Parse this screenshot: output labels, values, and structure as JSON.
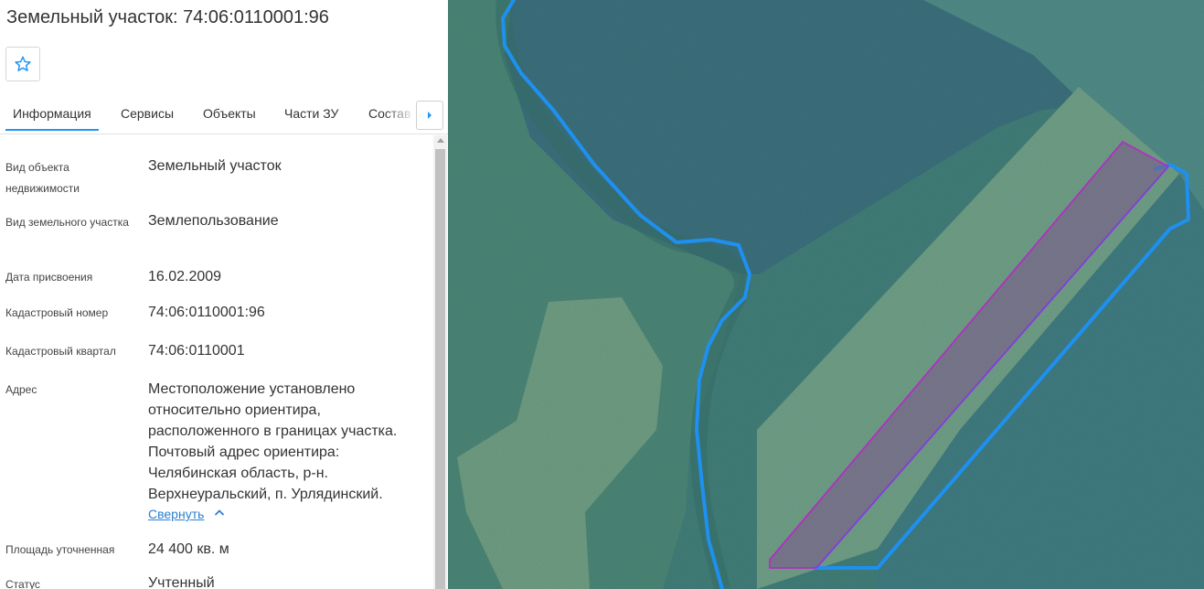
{
  "header": {
    "title": "Земельный участок: 74:06:0110001:96",
    "favorite_icon": "star-outline-icon"
  },
  "tabs": [
    {
      "label": "Информация",
      "active": true
    },
    {
      "label": "Сервисы",
      "active": false
    },
    {
      "label": "Объекты",
      "active": false
    },
    {
      "label": "Части ЗУ",
      "active": false
    },
    {
      "label": "Состав",
      "active": false
    }
  ],
  "info": {
    "object_type": {
      "label": "Вид объекта недвижимости",
      "value": "Земельный участок"
    },
    "land_type": {
      "label": "Вид земельного участка",
      "value": "Землепользование"
    },
    "assigned_date": {
      "label": "Дата присвоения",
      "value": "16.02.2009"
    },
    "cadastral_number": {
      "label": "Кадастровый номер",
      "value": "74:06:0110001:96"
    },
    "cadastral_quarter": {
      "label": "Кадастровый квартал",
      "value": "74:06:0110001"
    },
    "address": {
      "label": "Адрес",
      "lines": [
        "Местоположение установлено",
        "относительно ориентира,",
        "расположенного в границах участка.",
        "Почтовый адрес ориентира:",
        "Челябинская область, р-н.",
        "Верхнеуральский, п. Урлядинский."
      ],
      "collapse_label": "Свернуть"
    },
    "area": {
      "label": "Площадь уточненная",
      "value": "24 400 кв. м"
    },
    "status": {
      "label": "Статус",
      "value": "Учтенный"
    }
  },
  "colors": {
    "accent": "#2196f3",
    "link": "#2a7fd3",
    "parcel_fill": "#7a5a8c",
    "parcel_outline": "#b030c0",
    "boundary": "#1e90f0"
  }
}
